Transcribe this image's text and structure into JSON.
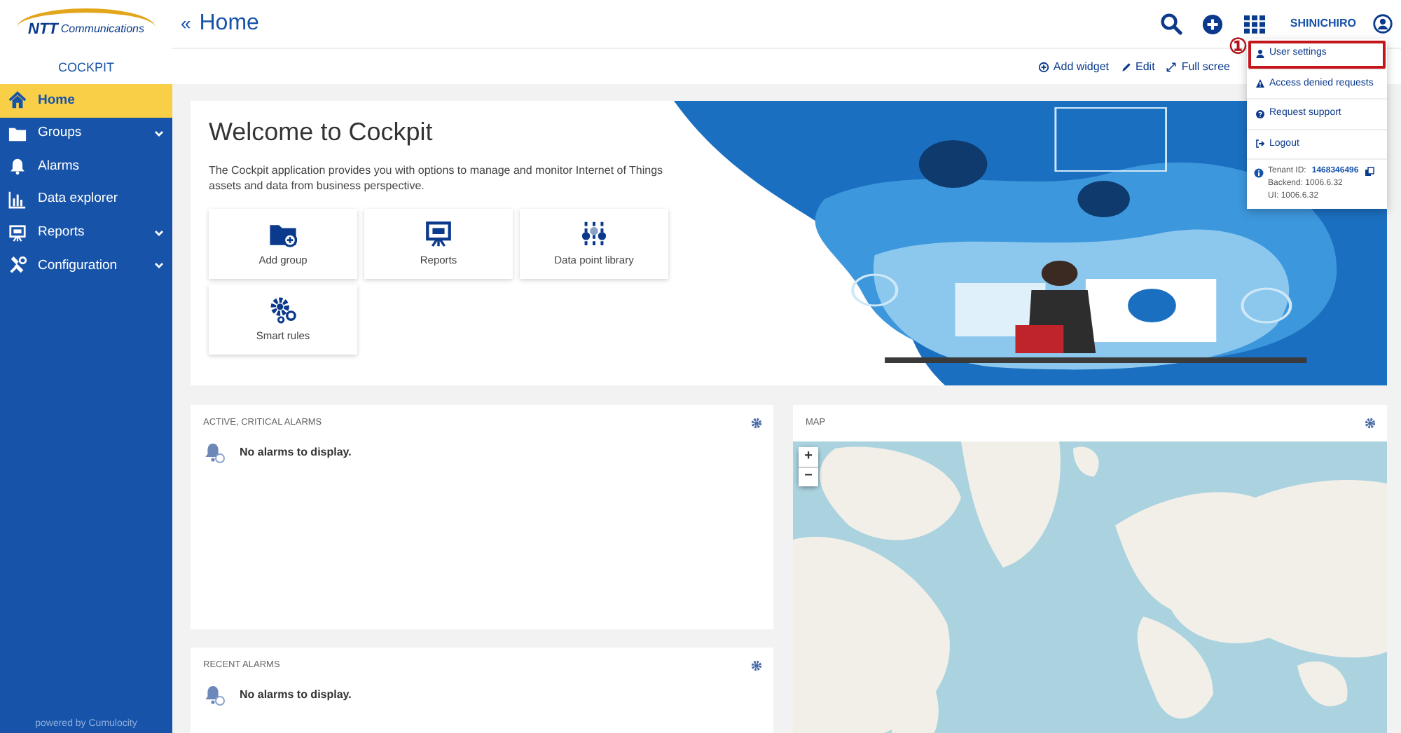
{
  "brand": {
    "logo_mark": "NTT",
    "logo_text": "Communications",
    "app_name": "COCKPIT"
  },
  "sidebar": {
    "items": [
      {
        "label": "Home",
        "kind": "home",
        "selected": true,
        "expandable": false
      },
      {
        "label": "Groups",
        "kind": "folder",
        "selected": false,
        "expandable": true
      },
      {
        "label": "Alarms",
        "kind": "bell",
        "selected": false,
        "expandable": false
      },
      {
        "label": "Data explorer",
        "kind": "chart",
        "selected": false,
        "expandable": false
      },
      {
        "label": "Reports",
        "kind": "board",
        "selected": false,
        "expandable": true
      },
      {
        "label": "Configuration",
        "kind": "tools",
        "selected": false,
        "expandable": true
      }
    ],
    "footer": "powered by Cumulocity"
  },
  "header": {
    "collapse": "«",
    "title": "Home",
    "user": "SHINICHIRO"
  },
  "toolbar": [
    {
      "label": "Add widget",
      "kind": "plus"
    },
    {
      "label": "Edit",
      "kind": "pencil"
    },
    {
      "label": "Full scree",
      "kind": "expand"
    }
  ],
  "welcome": {
    "title": "Welcome to Cockpit",
    "text": "The Cockpit application provides you with options to manage and monitor Internet of Things assets and data from business perspective.",
    "tiles": [
      {
        "label": "Add group",
        "kind": "folder-plus"
      },
      {
        "label": "Reports",
        "kind": "board"
      },
      {
        "label": "Data point library",
        "kind": "sliders"
      },
      {
        "label": "Smart rules",
        "kind": "gears"
      }
    ]
  },
  "widgets": [
    {
      "title": "ACTIVE, CRITICAL ALARMS",
      "message": "No alarms to display."
    },
    {
      "title": "RECENT ALARMS",
      "message": "No alarms to display."
    }
  ],
  "map": {
    "title": "MAP",
    "zoom_in": "+",
    "zoom_out": "−"
  },
  "user_menu": {
    "items": [
      {
        "label": "User settings",
        "kind": "user",
        "highlighted": true
      },
      {
        "label": "Access denied requests",
        "kind": "warning",
        "highlighted": false
      },
      {
        "label": "Request support",
        "kind": "question",
        "highlighted": false
      },
      {
        "label": "Logout",
        "kind": "logout",
        "highlighted": false
      }
    ],
    "tenant": {
      "label": "Tenant ID:",
      "id": "1468346496",
      "backend": "Backend: 1006.6.32",
      "ui": "UI: 1006.6.32"
    }
  },
  "annotation": "①"
}
